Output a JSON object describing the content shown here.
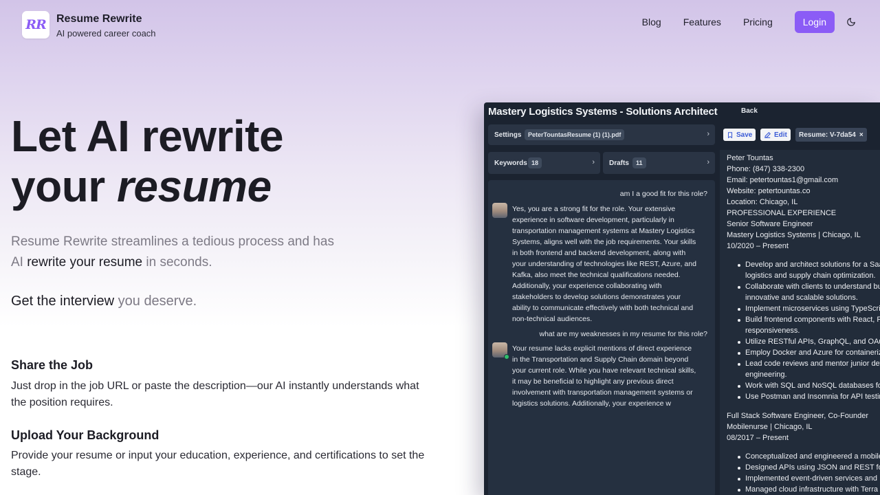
{
  "brand": {
    "logo_text": "RR",
    "name": "Resume Rewrite",
    "tagline": "AI powered career coach",
    "accent": "#8b5cf6"
  },
  "nav": {
    "links": [
      "Blog",
      "Features",
      "Pricing"
    ],
    "login": "Login",
    "theme_icon": "moon-icon"
  },
  "hero": {
    "title_line1": "Let AI rewrite",
    "title_line2_plain": "your ",
    "title_line2_em": "resume",
    "sub_a": "Resume Rewrite streamlines a tedious process and has AI ",
    "sub_b": "rewrite your resume",
    "sub_c": " in seconds.",
    "tag_a": "Get the interview",
    "tag_b": " you deserve."
  },
  "features": [
    {
      "title": "Share the Job",
      "desc": "Just drop in the job URL or paste the description—our AI instantly understands what the position requires."
    },
    {
      "title": "Upload Your Background",
      "desc": "Provide your resume or input your education, experience, and certifications to set the stage."
    }
  ],
  "app": {
    "title": "Mastery Logistics Systems - Solutions Architect",
    "back": "Back",
    "settings_label": "Settings",
    "settings_file": "PeterTountasResume (1) (1).pdf",
    "keywords_label": "Keywords",
    "keywords_count": "18",
    "drafts_label": "Drafts",
    "drafts_count": "11",
    "save": "Save",
    "edit": "Edit",
    "resume_tab": "Resume: V-7da54",
    "chat": {
      "q1": "am I a good fit for this role?",
      "a1": [
        "Yes, you are a strong fit for the role. Your extensive",
        "experience in software development, particularly in",
        "transportation management systems at Mastery Logistics",
        "Systems, aligns well with the job requirements. Your skills",
        "in both frontend and backend development, along with",
        "your understanding of technologies like REST, Azure, and",
        "Kafka, also meet the technical qualifications needed.",
        "Additionally, your experience collaborating with",
        "stakeholders to develop solutions demonstrates your",
        "ability to communicate effectively with both technical and",
        "non-technical audiences."
      ],
      "q2": "what are my weaknesses in my resume for this role?",
      "a2": [
        "Your resume lacks explicit mentions of direct experience",
        "in the Transportation and Supply Chain domain beyond",
        "your current role. While you have relevant technical skills,",
        "it may be beneficial to highlight any previous direct",
        "involvement with transportation management systems or",
        "logistics solutions. Additionally, your experience w"
      ]
    },
    "resume": {
      "header": [
        "Peter Tountas",
        "Phone: (847) 338-2300",
        "Email: petertountas1@gmail.com",
        "Website: petertountas.co",
        "Location: Chicago, IL",
        "PROFESSIONAL EXPERIENCE",
        "Senior Software Engineer",
        "Mastery Logistics Systems | Chicago, IL",
        "10/2020 – Present"
      ],
      "bullets1": [
        "Develop and architect solutions for a Saa",
        "logistics and supply chain optimization.",
        "Collaborate with clients to understand bu",
        "innovative and scalable solutions.",
        "Implement microservices using TypeScri",
        "Build frontend components with React, R",
        "responsiveness.",
        "Utilize RESTful APIs, GraphQL, and OAut",
        "Employ Docker and Azure for containeriz",
        "Lead code reviews and mentor junior dev",
        "engineering.",
        "Work with SQL and NoSQL databases fo",
        "Use Postman and Insomnia for API testin"
      ],
      "job2": [
        "Full Stack Software Engineer, Co-Founder",
        "Mobilenurse | Chicago, IL",
        "08/2017 – Present"
      ],
      "bullets2": [
        "Conceptualized and engineered a mobile",
        "Designed APIs using JSON and REST for",
        "Implemented event-driven services and",
        "Managed cloud infrastructure with Terra"
      ]
    }
  }
}
